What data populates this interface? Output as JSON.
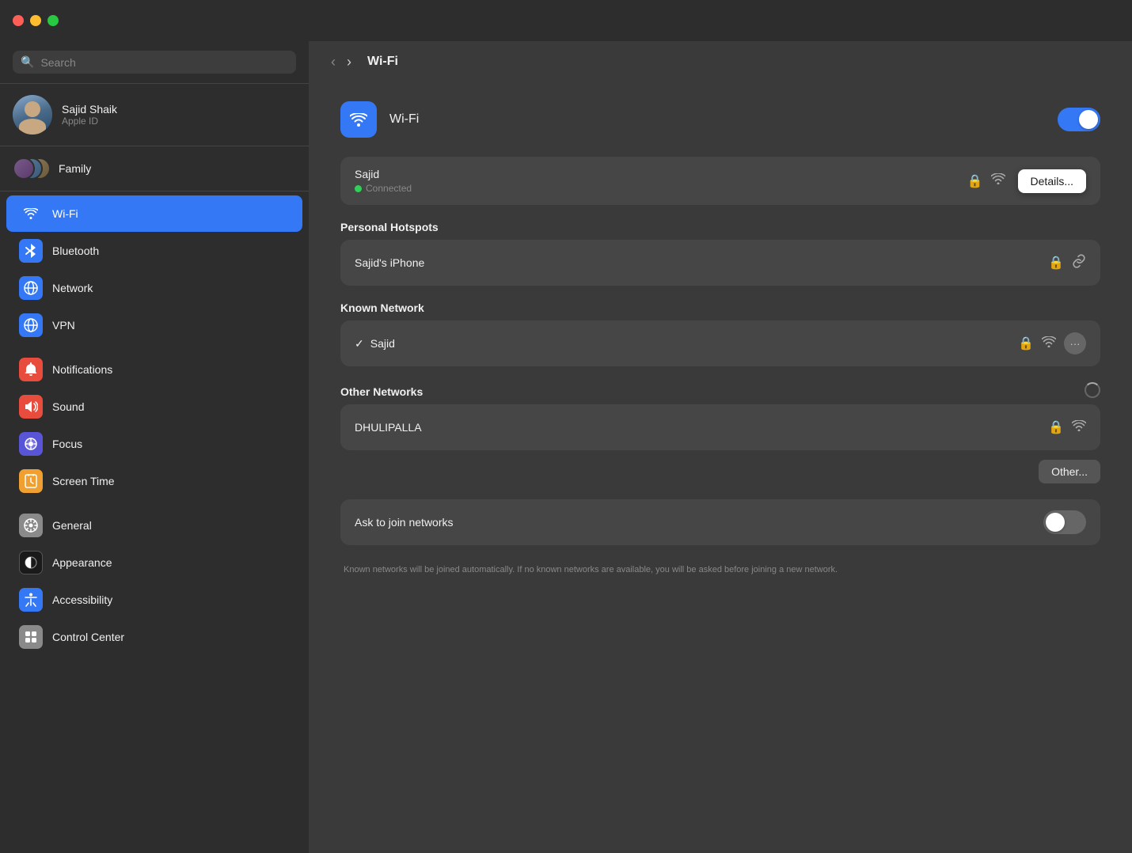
{
  "titlebar": {
    "traffic_lights": [
      "close",
      "minimize",
      "maximize"
    ]
  },
  "sidebar": {
    "search_placeholder": "Search",
    "user": {
      "name": "Sajid Shaik",
      "subtitle": "Apple ID"
    },
    "family_label": "Family",
    "nav_items": [
      {
        "id": "wifi",
        "label": "Wi-Fi",
        "icon_class": "icon-wifi",
        "icon_char": "📶",
        "active": true
      },
      {
        "id": "bluetooth",
        "label": "Bluetooth",
        "icon_class": "icon-bluetooth",
        "icon_char": "🔵",
        "active": false
      },
      {
        "id": "network",
        "label": "Network",
        "icon_class": "icon-network",
        "icon_char": "🌐",
        "active": false
      },
      {
        "id": "vpn",
        "label": "VPN",
        "icon_class": "icon-vpn",
        "icon_char": "🌐",
        "active": false
      },
      {
        "id": "notifications",
        "label": "Notifications",
        "icon_class": "icon-notifications",
        "icon_char": "🔔",
        "active": false
      },
      {
        "id": "sound",
        "label": "Sound",
        "icon_class": "icon-sound",
        "icon_char": "🔊",
        "active": false
      },
      {
        "id": "focus",
        "label": "Focus",
        "icon_class": "icon-focus",
        "icon_char": "🌙",
        "active": false
      },
      {
        "id": "screentime",
        "label": "Screen Time",
        "icon_class": "icon-screentime",
        "icon_char": "⏳",
        "active": false
      },
      {
        "id": "general",
        "label": "General",
        "icon_class": "icon-general",
        "icon_char": "⚙️",
        "active": false
      },
      {
        "id": "appearance",
        "label": "Appearance",
        "icon_class": "icon-appearance",
        "icon_char": "◑",
        "active": false
      },
      {
        "id": "accessibility",
        "label": "Accessibility",
        "icon_class": "icon-accessibility",
        "icon_char": "♿",
        "active": false
      },
      {
        "id": "controlcenter",
        "label": "Control Center",
        "icon_class": "icon-controlcenter",
        "icon_char": "⚙️",
        "active": false
      }
    ]
  },
  "content": {
    "title": "Wi-Fi",
    "wifi_label": "Wi-Fi",
    "toggle_on": true,
    "sections": {
      "connected": {
        "network_name": "Sajid",
        "connected_text": "Connected",
        "details_button": "Details..."
      },
      "personal_hotspots": {
        "label": "Personal Hotspots",
        "items": [
          {
            "name": "Sajid's iPhone",
            "lock": true,
            "link": true
          }
        ]
      },
      "known_network": {
        "label": "Known Network",
        "items": [
          {
            "name": "Sajid",
            "checked": true,
            "lock": true,
            "wifi": true
          }
        ]
      },
      "other_networks": {
        "label": "Other Networks",
        "loading": true,
        "items": [
          {
            "name": "DHULIPALLA",
            "lock": true,
            "wifi": true
          }
        ],
        "other_button": "Other..."
      }
    },
    "ask_join": {
      "title": "Ask to join networks",
      "subtitle": "Known networks will be joined automatically. If no known networks are available, you will be asked before joining a new network.",
      "toggle_on": false
    }
  }
}
